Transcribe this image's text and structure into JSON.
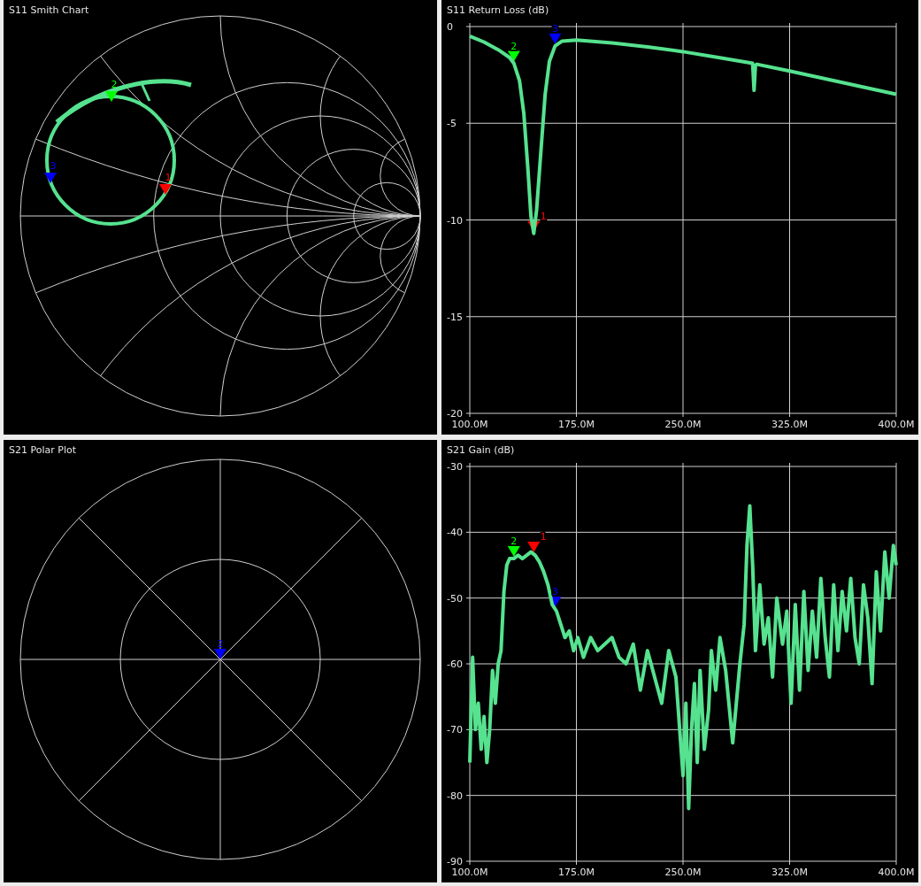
{
  "panels": [
    {
      "kind": "smith",
      "title": "S11 Smith Chart",
      "markers": [
        {
          "label": "1",
          "color": "#ff0000"
        },
        {
          "label": "2",
          "color": "#00ff00"
        },
        {
          "label": "3",
          "color": "#0000ff"
        }
      ]
    },
    {
      "kind": "line",
      "title": "S11 Return Loss (dB)",
      "chart_data": {
        "type": "line",
        "x": [
          100,
          110,
          120,
          128,
          131,
          135,
          138,
          141,
          143,
          145,
          147,
          150,
          153,
          156,
          160,
          165,
          175,
          200,
          225,
          250,
          275,
          299,
          300,
          301,
          302,
          325,
          350,
          375,
          400
        ],
        "series": [
          {
            "color": "#56e28f",
            "values": [
              -0.5,
              -0.8,
              -1.2,
              -1.6,
              -1.9,
              -2.8,
              -4.5,
              -7.5,
              -9.8,
              -10.7,
              -9.5,
              -6.5,
              -3.5,
              -1.8,
              -1.0,
              -0.75,
              -0.7,
              -0.85,
              -1.05,
              -1.3,
              -1.6,
              -1.9,
              -3.3,
              -2.0,
              -1.95,
              -2.3,
              -2.7,
              -3.1,
              -3.5
            ]
          }
        ],
        "xlim": [
          100,
          400
        ],
        "ylim": [
          -20,
          0
        ],
        "xticks": [
          {
            "value": 100,
            "label": "100.0M"
          },
          {
            "value": 175,
            "label": "175.0M"
          },
          {
            "value": 250,
            "label": "250.0M"
          },
          {
            "value": 325,
            "label": "325.0M"
          },
          {
            "value": 400,
            "label": "400.0M"
          }
        ],
        "yticks": [
          0,
          -5,
          -10,
          -15,
          -20
        ],
        "grid": true
      },
      "markers": [
        {
          "label": "1",
          "color": "#ff0000"
        },
        {
          "label": "2",
          "color": "#00ff00"
        },
        {
          "label": "3",
          "color": "#0000ff"
        }
      ]
    },
    {
      "kind": "polar",
      "title": "S21 Polar Plot",
      "markers": [
        {
          "label": "2",
          "color": "#0000ff"
        }
      ]
    },
    {
      "kind": "line",
      "title": "S21 Gain (dB)",
      "chart_data": {
        "type": "line",
        "x": [
          100,
          102,
          104,
          106,
          108,
          110,
          112,
          114,
          116,
          118,
          120,
          122,
          124,
          126,
          128,
          131,
          134,
          137,
          140,
          143,
          146,
          149,
          152,
          155,
          158,
          161,
          164,
          167,
          170,
          173,
          176,
          180,
          185,
          190,
          195,
          200,
          205,
          210,
          215,
          220,
          225,
          230,
          235,
          240,
          245,
          250,
          252,
          254,
          256,
          258,
          260,
          262,
          265,
          268,
          270,
          273,
          276,
          280,
          285,
          290,
          293,
          295,
          297,
          299,
          301,
          304,
          307,
          310,
          313,
          316,
          320,
          323,
          326,
          329,
          332,
          335,
          338,
          341,
          344,
          347,
          350,
          353,
          356,
          359,
          362,
          365,
          368,
          371,
          374,
          377,
          380,
          383,
          386,
          389,
          392,
          395,
          398,
          400
        ],
        "series": [
          {
            "color": "#56e28f",
            "values": [
              -75,
              -59,
              -70,
              -66,
              -73,
              -68,
              -75,
              -70,
              -61,
              -66,
              -60,
              -58,
              -49,
              -45,
              -44,
              -44,
              -43.5,
              -44,
              -43.5,
              -43,
              -43.5,
              -44.5,
              -46,
              -48,
              -51,
              -52,
              -54,
              -56,
              -55,
              -58,
              -56,
              -59,
              -56,
              -58,
              -57,
              -56,
              -59,
              -60,
              -57,
              -64,
              -58,
              -62,
              -66,
              -58,
              -62,
              -77,
              -66,
              -82,
              -70,
              -63,
              -75,
              -61,
              -73,
              -67,
              -58,
              -64,
              -56,
              -61,
              -72,
              -60,
              -54,
              -42,
              -36,
              -45,
              -58,
              -48,
              -57,
              -53,
              -62,
              -50,
              -57,
              -52,
              -66,
              -51,
              -64,
              -49,
              -61,
              -52,
              -59,
              -47,
              -56,
              -62,
              -48,
              -58,
              -49,
              -55,
              -47,
              -56,
              -60,
              -48,
              -53,
              -63,
              -46,
              -55,
              -43,
              -50,
              -42,
              -45
            ]
          }
        ],
        "xlim": [
          100,
          400
        ],
        "ylim": [
          -90,
          -30
        ],
        "xticks": [
          {
            "value": 100,
            "label": "100.0M"
          },
          {
            "value": 175,
            "label": "175.0M"
          },
          {
            "value": 250,
            "label": "250.0M"
          },
          {
            "value": 325,
            "label": "325.0M"
          },
          {
            "value": 400,
            "label": "400.0M"
          }
        ],
        "yticks": [
          -30,
          -40,
          -50,
          -60,
          -70,
          -80,
          -90
        ],
        "grid": true
      },
      "markers": [
        {
          "label": "1",
          "color": "#ff0000"
        },
        {
          "label": "2",
          "color": "#00ff00"
        },
        {
          "label": "3",
          "color": "#0000ff"
        }
      ]
    }
  ]
}
